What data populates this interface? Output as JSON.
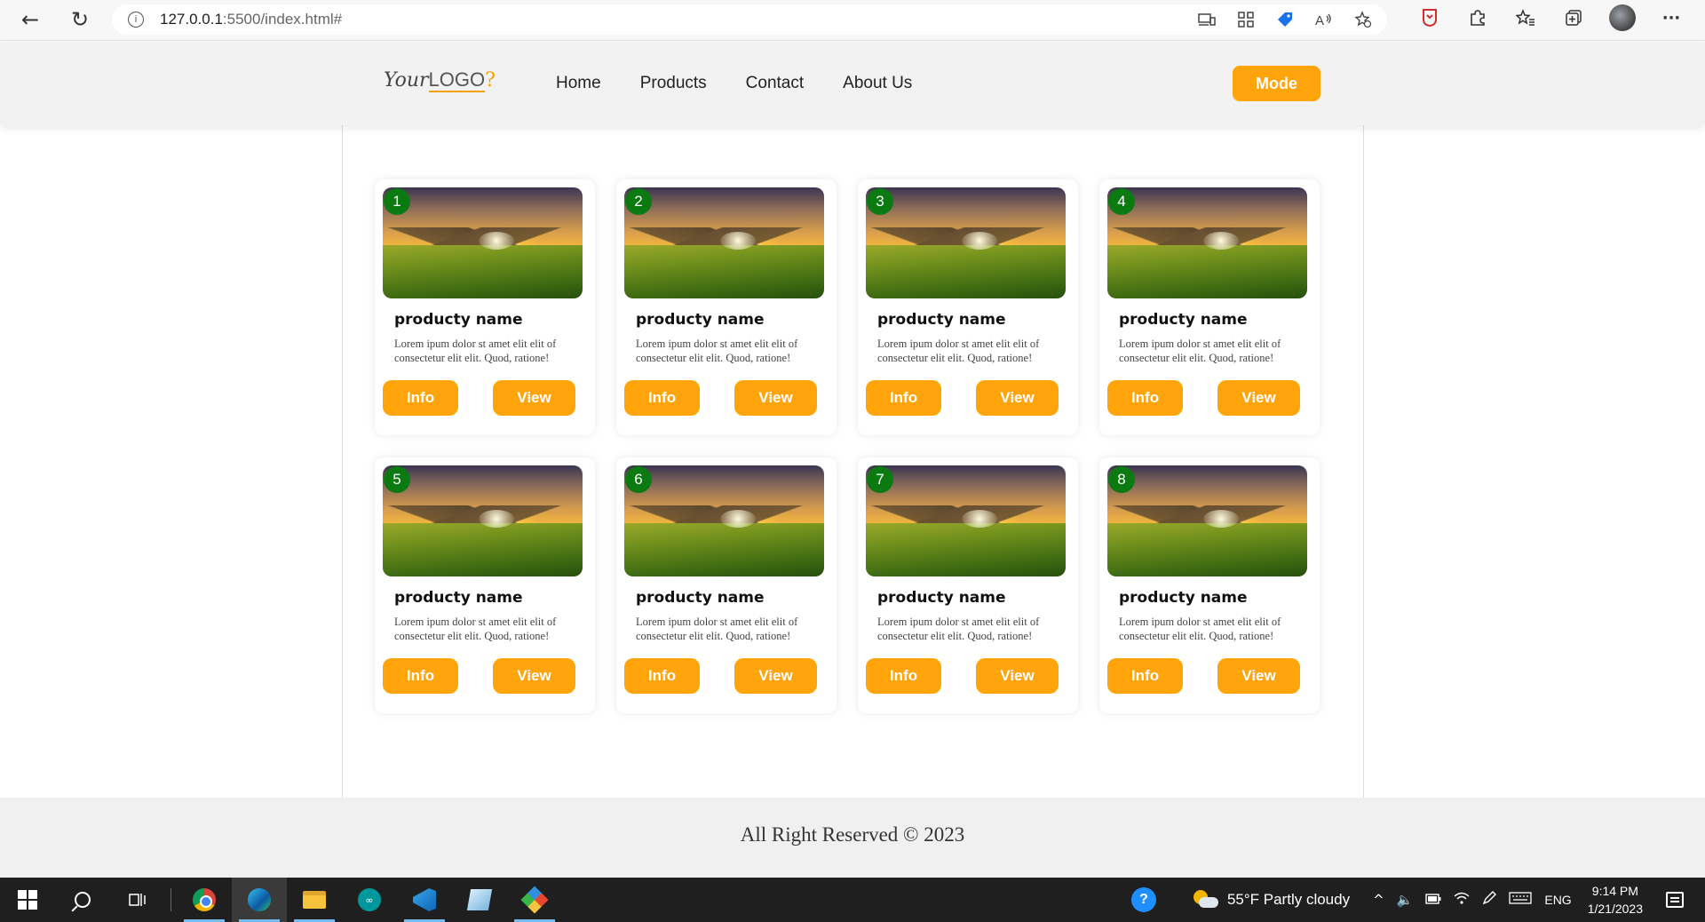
{
  "browser": {
    "url_host": "127.0.0.1",
    "url_path": ":5500/index.html#",
    "info_symbol": "i",
    "back_symbol": "←",
    "reload_symbol": "↻",
    "more_symbol": "···",
    "address_icons": [
      "devices-icon",
      "apps-icon",
      "shopping-tag-icon",
      "read-aloud-icon",
      "add-favorite-icon"
    ],
    "right_icons": [
      "pdf-icon",
      "extensions-icon",
      "favorites-icon",
      "collections-icon",
      "profile-icon",
      "more-icon"
    ]
  },
  "header": {
    "logo_prefix": "Your",
    "logo_main": "LOGO",
    "logo_suffix": "?",
    "nav": [
      "Home",
      "Products",
      "Contact",
      "About Us"
    ],
    "mode_label": "Mode",
    "accent_color": "#ffa40a"
  },
  "products": [
    {
      "number": "1",
      "name": "producty name",
      "description": "Lorem ipum dolor st amet elit elit of consectetur elit elit. Quod, ratione!",
      "info_label": "Info",
      "view_label": "View"
    },
    {
      "number": "2",
      "name": "producty name",
      "description": "Lorem ipum dolor st amet elit elit of consectetur elit elit. Quod, ratione!",
      "info_label": "Info",
      "view_label": "View"
    },
    {
      "number": "3",
      "name": "producty name",
      "description": "Lorem ipum dolor st amet elit elit of consectetur elit elit. Quod, ratione!",
      "info_label": "Info",
      "view_label": "View"
    },
    {
      "number": "4",
      "name": "producty name",
      "description": "Lorem ipum dolor st amet elit elit of consectetur elit elit. Quod, ratione!",
      "info_label": "Info",
      "view_label": "View"
    },
    {
      "number": "5",
      "name": "producty name",
      "description": "Lorem ipum dolor st amet elit elit of consectetur elit elit. Quod, ratione!",
      "info_label": "Info",
      "view_label": "View"
    },
    {
      "number": "6",
      "name": "producty name",
      "description": "Lorem ipum dolor st amet elit elit of consectetur elit elit. Quod, ratione!",
      "info_label": "Info",
      "view_label": "View"
    },
    {
      "number": "7",
      "name": "producty name",
      "description": "Lorem ipum dolor st amet elit elit of consectetur elit elit. Quod, ratione!",
      "info_label": "Info",
      "view_label": "View"
    },
    {
      "number": "8",
      "name": "producty name",
      "description": "Lorem ipum dolor st amet elit elit of consectetur elit elit. Quod, ratione!",
      "info_label": "Info",
      "view_label": "View"
    }
  ],
  "badge_color": "#0b7a11",
  "footer": {
    "text": "All Right Reserved © 2023"
  },
  "taskbar": {
    "apps": [
      "windows-start-icon",
      "search-icon",
      "task-view-icon",
      "chrome-icon",
      "edge-icon",
      "file-explorer-icon",
      "arduino-icon",
      "vscode-icon",
      "notepad-icon",
      "git-icon"
    ],
    "weather": "55°F  Partly cloudy",
    "language": "ENG",
    "time": "9:14 PM",
    "date": "1/21/2023"
  }
}
